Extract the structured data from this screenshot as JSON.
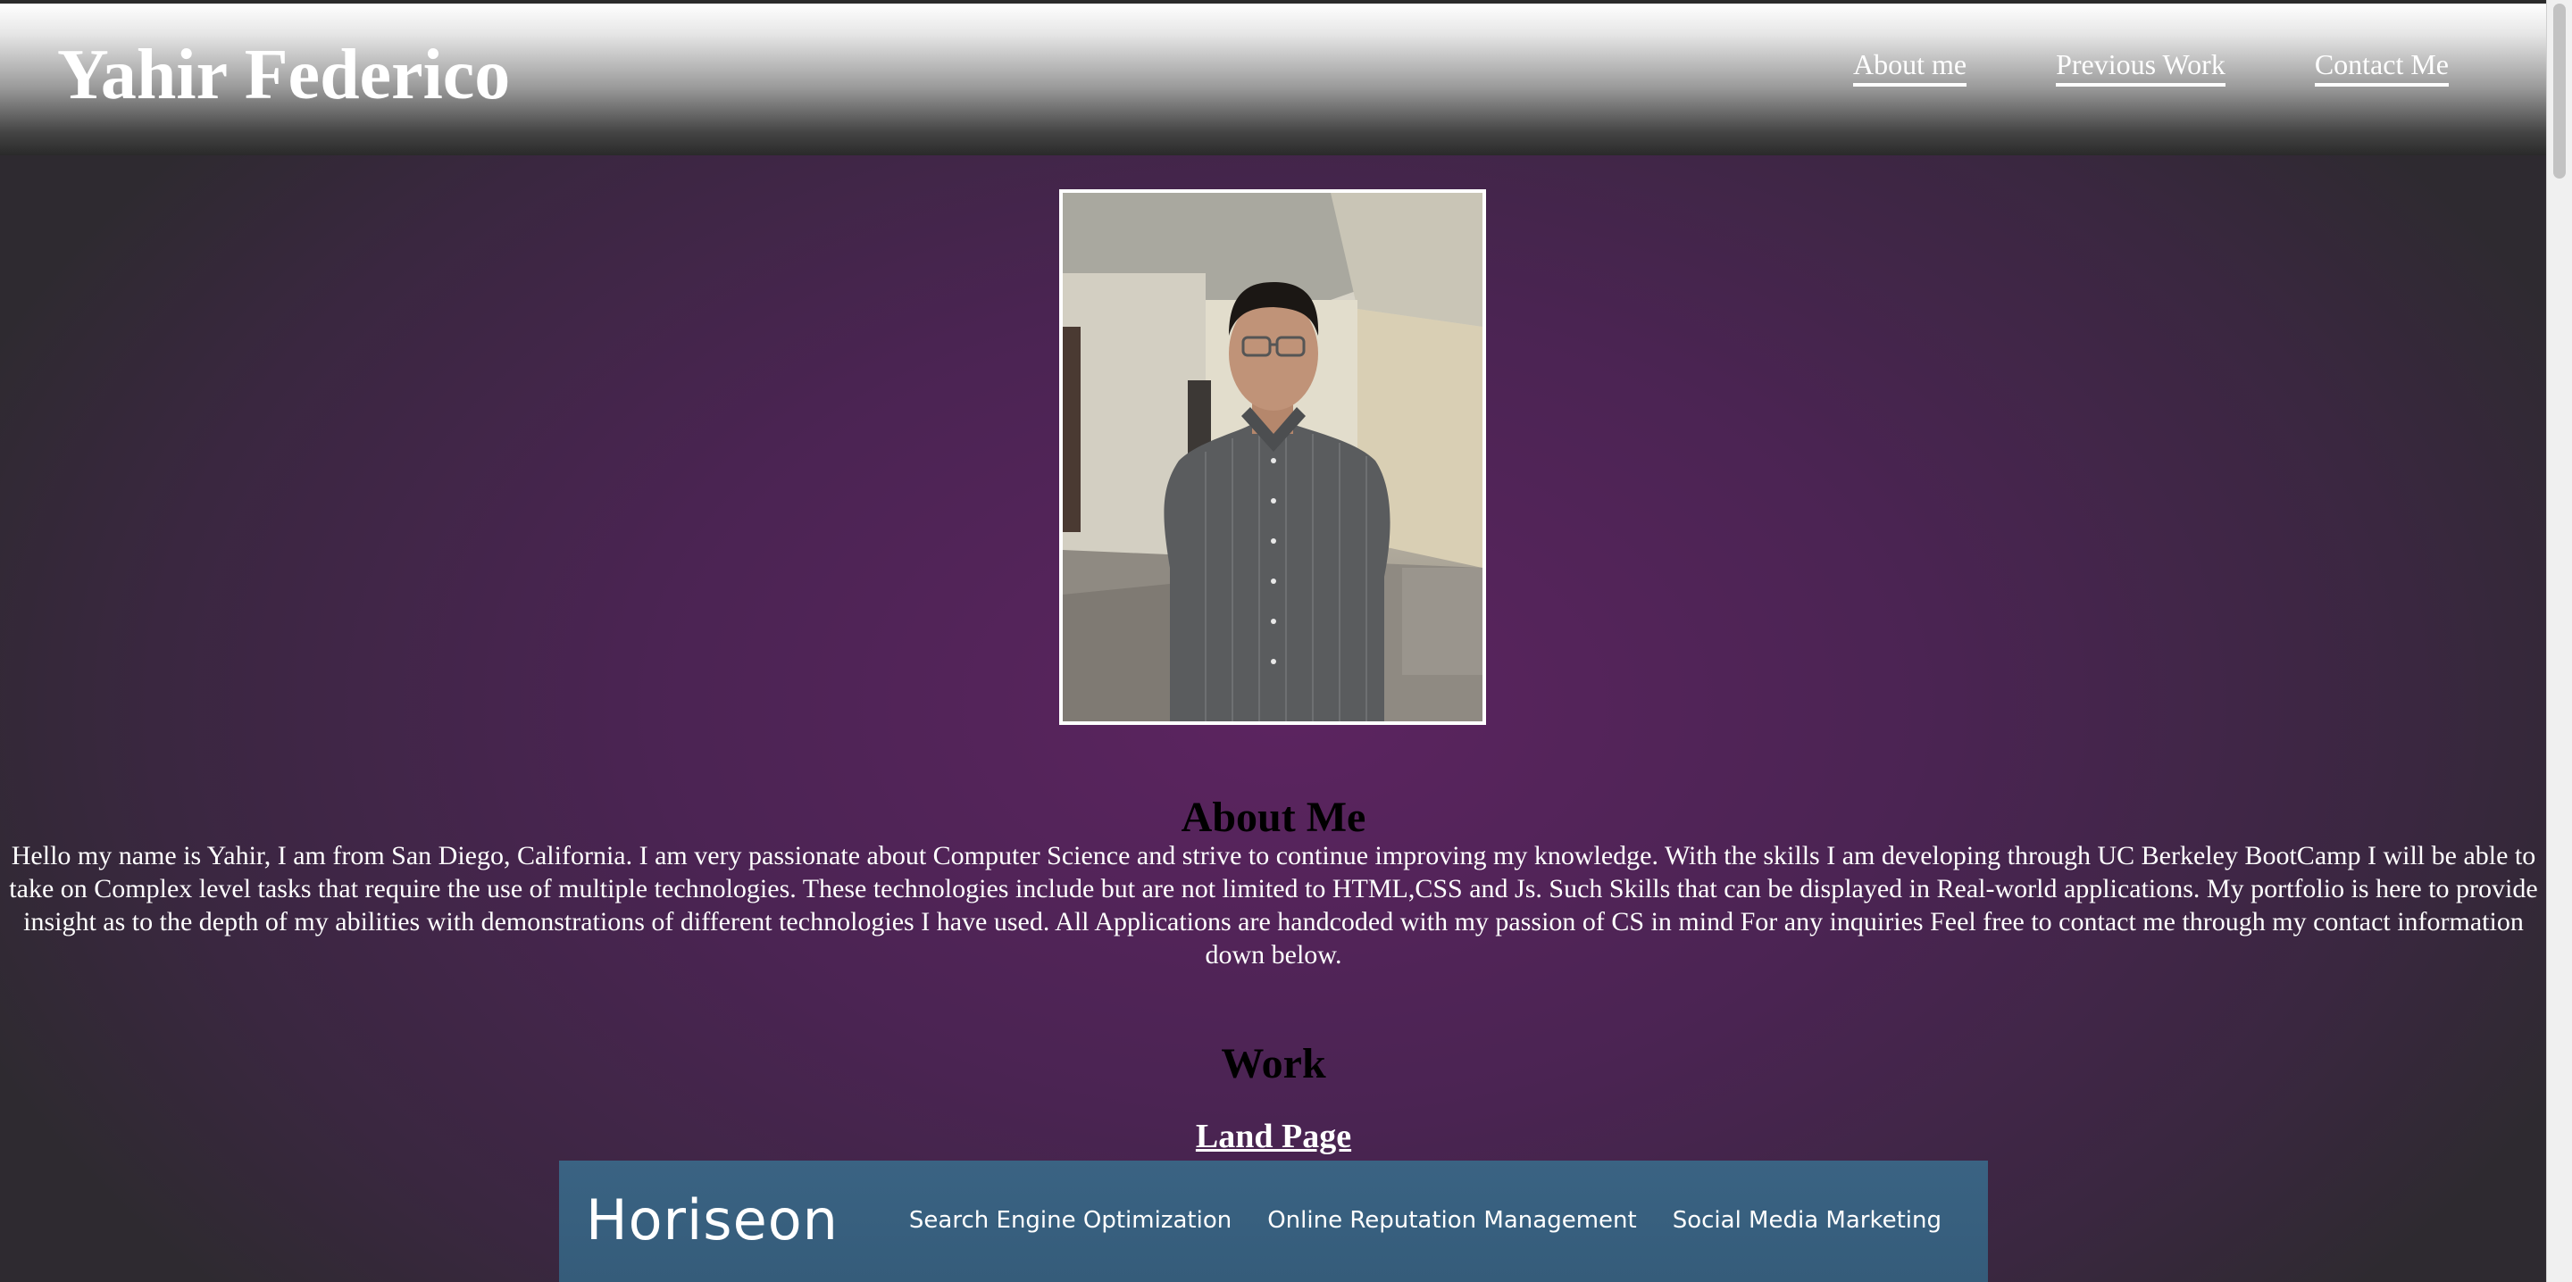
{
  "header": {
    "title": "Yahir Federico",
    "nav": [
      {
        "label": "About me"
      },
      {
        "label": "Previous Work"
      },
      {
        "label": "Contact Me"
      }
    ]
  },
  "about": {
    "heading": "About Me",
    "text": "Hello my name is Yahir, I am from San Diego, California. I am very passionate about Computer Science and strive to continue improving my knowledge. With the skills I am developing through UC Berkeley BootCamp I will be able to take on Complex level tasks that require the use of multiple technologies. These technologies include but are not limited to HTML,CSS and Js. Such Skills that can be displayed in Real-world applications. My portfolio is here to provide insight as to the depth of my abilities with demonstrations of different technologies I have used. All Applications are handcoded with my passion of CS in mind For any inquiries Feel free to contact me through my contact information down below."
  },
  "work": {
    "heading": "Work",
    "projects": [
      {
        "title": "Land Page",
        "preview": {
          "brand": "Horiseon",
          "nav": [
            "Search Engine Optimization",
            "Online Reputation Management",
            "Social Media Marketing"
          ]
        }
      }
    ]
  },
  "colors": {
    "background_center": "#5c2460",
    "background_edge": "#2e2a30",
    "header_top": "#ffffff",
    "header_bottom": "#2a2a2a",
    "preview_bg": "#3a6383"
  }
}
